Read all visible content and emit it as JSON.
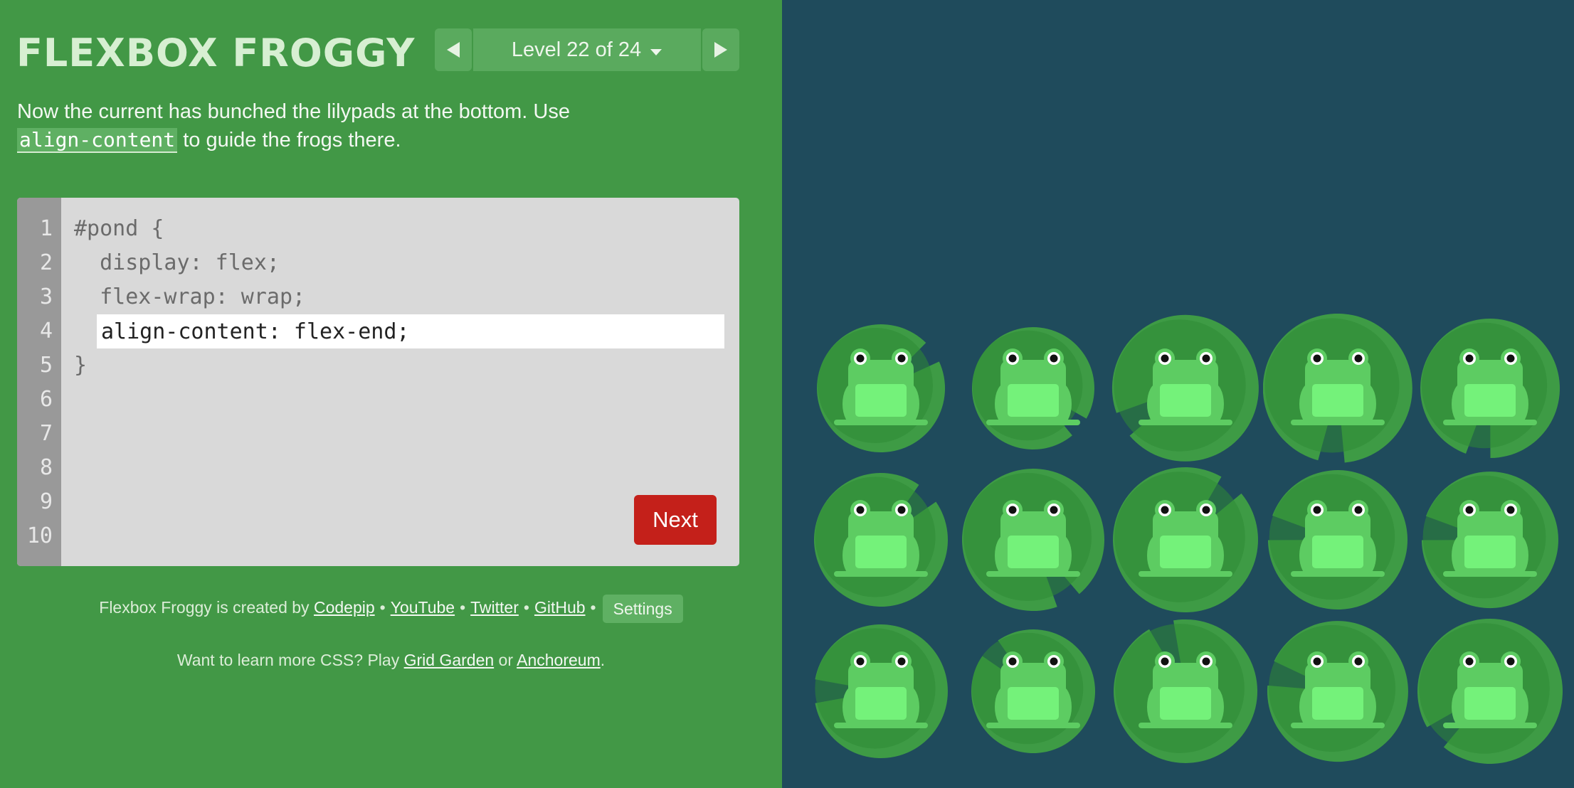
{
  "app": {
    "title": "FLEXBOX FROGGY"
  },
  "level_nav": {
    "level_label": "Level 22 of 24",
    "current_level": 22,
    "total_levels": 24
  },
  "instructions": {
    "text_before": "Now the current has bunched the lilypads at the bottom. Use ",
    "code_term": "align-content",
    "text_after": " to guide the frogs there."
  },
  "editor": {
    "line_numbers": [
      "1",
      "2",
      "3",
      "4",
      "5",
      "6",
      "7",
      "8",
      "9",
      "10"
    ],
    "lines": [
      "#pond {",
      "  display: flex;",
      "  flex-wrap: wrap;",
      "}"
    ],
    "input_value": "align-content: flex-end;",
    "next_label": "Next"
  },
  "footer": {
    "credits_prefix": "Flexbox Froggy is created by ",
    "links": [
      "Codepip",
      "YouTube",
      "Twitter",
      "GitHub"
    ],
    "separator": "•",
    "settings_label": "Settings",
    "learn_prefix": "Want to learn more CSS? Play ",
    "learn_link_1": "Grid Garden",
    "learn_middle": " or ",
    "learn_link_2": "Anchoreum",
    "learn_suffix": "."
  },
  "pond": {
    "frog_count": 15,
    "frog_color": "green"
  },
  "colors": {
    "sidebar_bg": "#429846",
    "pond_bg": "#1f4b5c",
    "lilypad": "#3e9b45",
    "lilypad_inner": "#2e8a35",
    "frog_body": "#5dcc62",
    "frog_belly": "#74f27a",
    "next_button": "#c4201a"
  }
}
